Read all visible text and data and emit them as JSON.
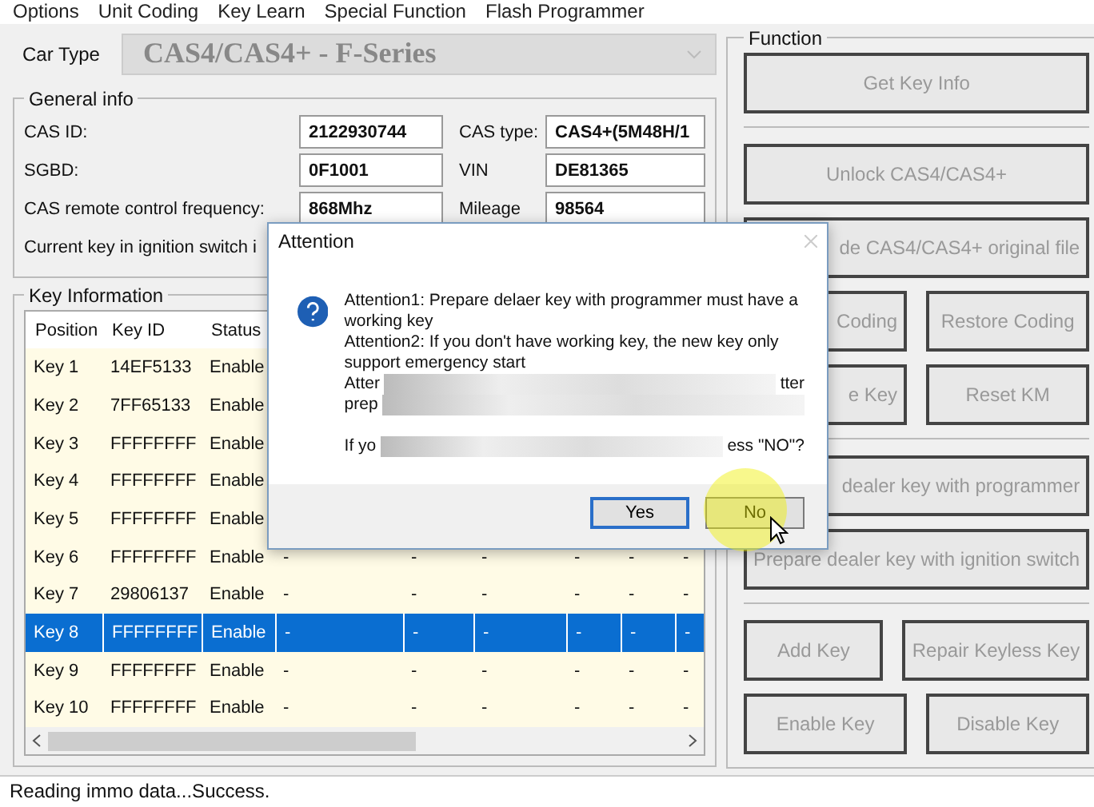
{
  "menu": [
    "Options",
    "Unit Coding",
    "Key Learn",
    "Special Function",
    "Flash Programmer"
  ],
  "car_type": {
    "label": "Car Type",
    "value": "CAS4/CAS4+ - F-Series",
    "disabled": true
  },
  "general_info": {
    "title": "General info",
    "fields": [
      {
        "label": "CAS ID:",
        "value": "2122930744",
        "label_2": "CAS type:",
        "value_2": "CAS4+(5M48H/1"
      },
      {
        "label": "SGBD:",
        "value": "0F1001",
        "label_2": "VIN",
        "value_2": "DE81365"
      },
      {
        "label": "CAS remote control frequency:",
        "value": "868Mhz",
        "label_2": "Mileage",
        "value_2": "98564"
      },
      {
        "label": "Current key in ignition switch i"
      }
    ]
  },
  "key_info": {
    "title": "Key Information",
    "columns": [
      "Position",
      "Key ID",
      "Status"
    ],
    "rows": [
      {
        "cells": [
          "Key 1",
          "14EF5133",
          "Enable"
        ],
        "selected": false
      },
      {
        "cells": [
          "Key 2",
          "7FF65133",
          "Enable"
        ],
        "selected": false
      },
      {
        "cells": [
          "Key 3",
          "FFFFFFFF",
          "Enable"
        ],
        "selected": false
      },
      {
        "cells": [
          "Key 4",
          "FFFFFFFF",
          "Enable"
        ],
        "selected": false
      },
      {
        "cells": [
          "Key 5",
          "FFFFFFFF",
          "Enable"
        ],
        "selected": false
      },
      {
        "cells": [
          "Key 6",
          "FFFFFFFF",
          "Enable",
          "-",
          "-",
          "-",
          "-",
          "-",
          "-"
        ],
        "selected": false
      },
      {
        "cells": [
          "Key 7",
          "29806137",
          "Enable",
          "-",
          "-",
          "-",
          "-",
          "-",
          "-"
        ],
        "selected": false
      },
      {
        "cells": [
          "Key 8",
          "FFFFFFFF",
          "Enable",
          "-",
          "-",
          "-",
          "-",
          "-",
          "-"
        ],
        "selected": true
      },
      {
        "cells": [
          "Key 9",
          "FFFFFFFF",
          "Enable",
          "-",
          "-",
          "-",
          "-",
          "-",
          "-"
        ],
        "selected": false
      },
      {
        "cells": [
          "Key 10",
          "FFFFFFFF",
          "Enable",
          "-",
          "-",
          "-",
          "-",
          "-",
          "-"
        ],
        "selected": false
      }
    ]
  },
  "function": {
    "title": "Function",
    "groups": [
      [
        [
          "Get Key Info"
        ]
      ],
      [
        [
          "Unlock CAS4/CAS4+"
        ],
        [
          "de CAS4/CAS4+ original file"
        ],
        [
          "Coding",
          "Restore Coding"
        ],
        [
          "e Key",
          "Reset KM"
        ]
      ],
      [
        [
          "dealer key with programmer"
        ],
        [
          "Prepare dealer key with ignition switch"
        ]
      ],
      [
        [
          "Add Key",
          "Repair Keyless Key"
        ],
        [
          "Enable Key",
          "Disable Key"
        ]
      ]
    ],
    "disabled": true
  },
  "status_bar": "Reading immo data...Success.",
  "dialog": {
    "title": "Attention",
    "lines": [
      "Attention1: Prepare delaer key with programmer must have a working key",
      "Attention2: If you don't have working key, the new key only support emergency start"
    ],
    "blurred_lines": [
      {
        "start": "Atter",
        "end": "tter"
      },
      {
        "start": "prep"
      },
      {
        "start": "If yo",
        "end": "ess \"NO\"?"
      }
    ],
    "buttons": [
      {
        "label": "Yes",
        "focused": true
      },
      {
        "label": "No",
        "focused": false
      }
    ]
  }
}
